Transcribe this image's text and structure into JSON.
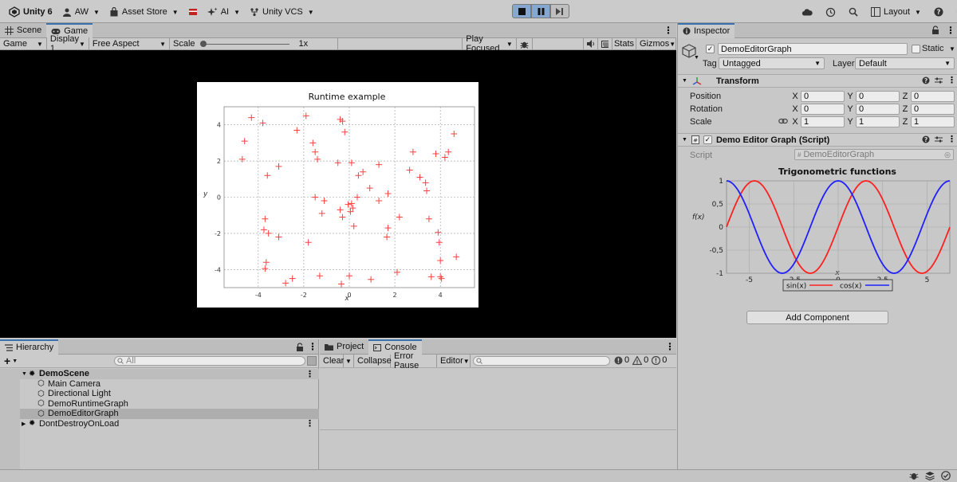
{
  "toolbar": {
    "app_title": "Unity 6",
    "account": "AW",
    "asset_store": "Asset Store",
    "ai": "AI",
    "vcs": "Unity VCS",
    "layout": "Layout"
  },
  "scene_tabs": [
    {
      "label": "Scene",
      "icon": "grid-icon",
      "selected": false
    },
    {
      "label": "Game",
      "icon": "gamepad-icon",
      "selected": true
    }
  ],
  "game_bar": {
    "mode": "Game",
    "display": "Display 1",
    "aspect": "Free Aspect",
    "scale_label": "Scale",
    "scale_value": "1x",
    "play_focused": "Play Focused",
    "stats": "Stats",
    "gizmos": "Gizmos"
  },
  "runtime_chart": {
    "chart_data": {
      "type": "scatter",
      "title": "Runtime example",
      "xlabel": "x",
      "ylabel": "y",
      "xlim": [
        -5.5,
        5.5
      ],
      "ylim": [
        -5,
        5
      ],
      "xticks": [
        -4,
        -2,
        0,
        2,
        4
      ],
      "yticks": [
        -4,
        -2,
        0,
        2,
        4
      ],
      "marker": "+",
      "color": "#ff4040",
      "grid": true,
      "points": [
        [
          -4.7,
          2.1
        ],
        [
          -4.6,
          3.1
        ],
        [
          -4.3,
          4.4
        ],
        [
          -3.8,
          4.1
        ],
        [
          -3.6,
          1.2
        ],
        [
          -3.1,
          1.7
        ],
        [
          -3.7,
          -1.2
        ],
        [
          -3.75,
          -1.8
        ],
        [
          -3.55,
          -2.0
        ],
        [
          -3.1,
          -2.2
        ],
        [
          -3.65,
          -3.6
        ],
        [
          -3.7,
          -3.95
        ],
        [
          -2.8,
          -4.75
        ],
        [
          -2.5,
          -4.5
        ],
        [
          -2.3,
          3.7
        ],
        [
          -1.9,
          4.5
        ],
        [
          -1.6,
          3.0
        ],
        [
          -1.5,
          2.5
        ],
        [
          -1.4,
          2.1
        ],
        [
          -1.5,
          0.0
        ],
        [
          -1.1,
          -0.2
        ],
        [
          -1.2,
          -0.9
        ],
        [
          -1.8,
          -2.5
        ],
        [
          -1.3,
          -4.35
        ],
        [
          -0.4,
          4.3
        ],
        [
          -0.3,
          4.2
        ],
        [
          -0.2,
          3.6
        ],
        [
          -0.5,
          1.9
        ],
        [
          -0.4,
          -0.7
        ],
        [
          -0.3,
          -1.1
        ],
        [
          -0.35,
          -4.8
        ],
        [
          0.1,
          1.9
        ],
        [
          0.4,
          1.2
        ],
        [
          0.6,
          1.4
        ],
        [
          0.35,
          0.0
        ],
        [
          0.1,
          -0.35
        ],
        [
          0.15,
          -0.6
        ],
        [
          0.05,
          -0.8
        ],
        [
          0.2,
          -1.6
        ],
        [
          0.9,
          0.5
        ],
        [
          1.3,
          -0.2
        ],
        [
          1.3,
          1.8
        ],
        [
          1.7,
          0.2
        ],
        [
          1.7,
          -1.7
        ],
        [
          1.65,
          -2.2
        ],
        [
          0.95,
          -4.55
        ],
        [
          2.1,
          -4.15
        ],
        [
          2.2,
          -1.1
        ],
        [
          0.0,
          -4.35
        ],
        [
          -0.05,
          -0.4
        ],
        [
          2.8,
          2.5
        ],
        [
          2.65,
          1.5
        ],
        [
          3.1,
          1.1
        ],
        [
          3.35,
          0.8
        ],
        [
          3.4,
          0.35
        ],
        [
          3.5,
          -1.2
        ],
        [
          3.8,
          2.4
        ],
        [
          3.9,
          -1.95
        ],
        [
          3.95,
          -2.5
        ],
        [
          4.0,
          -3.5
        ],
        [
          4.0,
          -4.4
        ],
        [
          4.2,
          2.2
        ],
        [
          4.35,
          2.5
        ],
        [
          4.6,
          3.5
        ],
        [
          4.7,
          -3.3
        ],
        [
          3.6,
          -4.4
        ],
        [
          4.05,
          -4.5
        ]
      ]
    }
  },
  "inspector": {
    "tab": "Inspector",
    "object_name": "DemoEditorGraph",
    "static_label": "Static",
    "tag_label": "Tag",
    "tag_value": "Untagged",
    "layer_label": "Layer",
    "layer_value": "Default",
    "transform": {
      "title": "Transform",
      "rows": [
        {
          "label": "Position",
          "x": "0",
          "y": "0",
          "z": "0"
        },
        {
          "label": "Rotation",
          "x": "0",
          "y": "0",
          "z": "0"
        },
        {
          "label": "Scale",
          "x": "1",
          "y": "1",
          "z": "1"
        }
      ],
      "axis": {
        "x": "X",
        "y": "Y",
        "z": "Z"
      }
    },
    "script_component": {
      "title": "Demo Editor Graph (Script)",
      "script_label": "Script",
      "script_value": "DemoEditorGraph"
    },
    "add_component": "Add Component"
  },
  "trig_chart": {
    "chart_data": {
      "type": "line",
      "title": "Trigonometric functions",
      "xlabel": "x",
      "ylabel": "f(x)",
      "xlim": [
        -6.28,
        6.28
      ],
      "ylim": [
        -1,
        1
      ],
      "xticks": [
        -5,
        -2.5,
        0,
        2.5,
        5
      ],
      "xtick_labels": [
        "-5",
        "-2,5",
        "0",
        "2,5",
        "5"
      ],
      "yticks": [
        1,
        0.5,
        0,
        -0.5,
        -1
      ],
      "ytick_labels": [
        "1",
        "0,5",
        "0",
        "-0,5",
        "-1"
      ],
      "grid": true,
      "legend": "bottom-center",
      "series": [
        {
          "name": "sin(x)",
          "function": "sin",
          "color": "#ff2020"
        },
        {
          "name": "cos(x)",
          "function": "cos",
          "color": "#2020ff"
        }
      ]
    }
  },
  "hierarchy": {
    "tab": "Hierarchy",
    "search_placeholder": "All",
    "items": [
      {
        "label": "DemoScene",
        "level": 0,
        "bold": true,
        "expanded": true,
        "icon": "unity-scene-icon"
      },
      {
        "label": "Main Camera",
        "level": 1,
        "icon": "gameobject-cube-icon"
      },
      {
        "label": "Directional Light",
        "level": 1,
        "icon": "gameobject-cube-icon"
      },
      {
        "label": "DemoRuntimeGraph",
        "level": 1,
        "icon": "gameobject-cube-icon"
      },
      {
        "label": "DemoEditorGraph",
        "level": 1,
        "icon": "gameobject-cube-icon",
        "selected": true
      },
      {
        "label": "DontDestroyOnLoad",
        "level": 0,
        "expanded": false,
        "icon": "unity-scene-icon"
      }
    ]
  },
  "console": {
    "tabs": [
      {
        "label": "Project",
        "icon": "folder-icon",
        "selected": false
      },
      {
        "label": "Console",
        "icon": "console-icon",
        "selected": true
      }
    ],
    "clear": "Clear",
    "collapse": "Collapse",
    "error_pause": "Error Pause",
    "editor": "Editor",
    "counts": {
      "errors": "0",
      "warnings": "0",
      "messages": "0"
    }
  }
}
